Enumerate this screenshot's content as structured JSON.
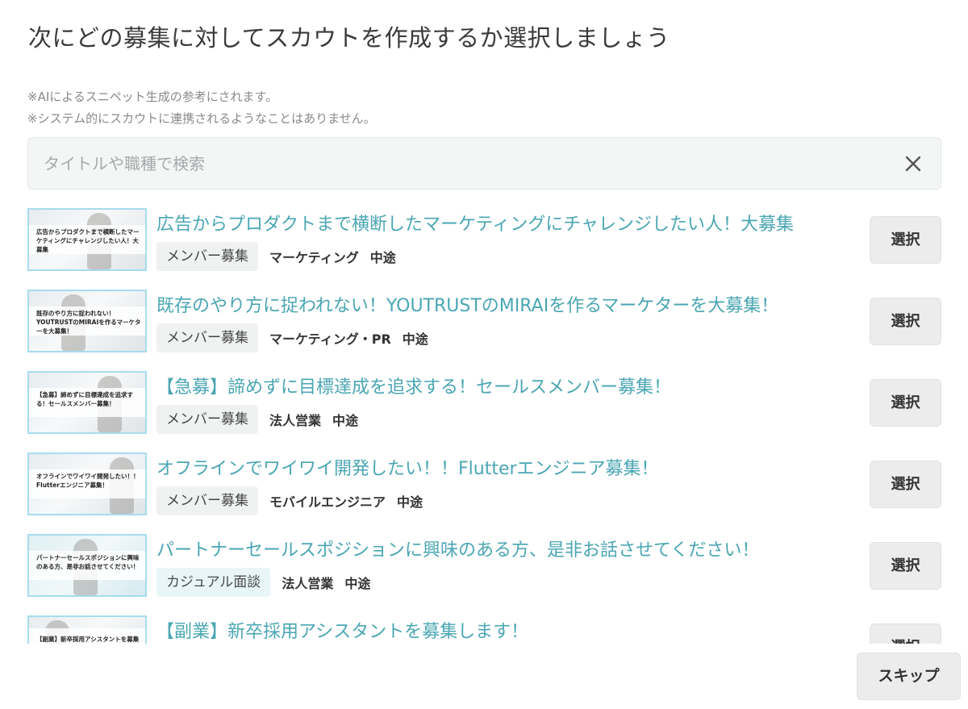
{
  "dialog": {
    "title": "次にどの募集に対してスカウトを作成するか選択しましょう",
    "notes": [
      "※AIによるスニペット生成の参考にされます。",
      "※システム的にスカウトに連携されるようなことはありません。"
    ]
  },
  "search": {
    "placeholder": "タイトルや職種で検索",
    "value": "",
    "clear_icon": "close-icon"
  },
  "jobs": [
    {
      "thumbnail_caption": "広告からプロダクトまで横断したマーケティングにチャレンジしたい人！大募集",
      "title": "広告からプロダクトまで横断したマーケティングにチャレンジしたい人！大募集",
      "recruit_type": "メンバー募集",
      "category": "マーケティング",
      "employment": "中途",
      "select_label": "選択"
    },
    {
      "thumbnail_caption": "既存のやり方に捉われない！YOUTRUSTのMIRAIを作るマーケターを大募集！",
      "title": "既存のやり方に捉われない！YOUTRUSTのMIRAIを作るマーケターを大募集！",
      "recruit_type": "メンバー募集",
      "category": "マーケティング・PR",
      "employment": "中途",
      "select_label": "選択"
    },
    {
      "thumbnail_caption": "【急募】諦めずに目標達成を追求する！セールスメンバー募集！",
      "title": "【急募】諦めずに目標達成を追求する！セールスメンバー募集！",
      "recruit_type": "メンバー募集",
      "category": "法人営業",
      "employment": "中途",
      "select_label": "選択"
    },
    {
      "thumbnail_caption": "オフラインでワイワイ開発したい！！Flutterエンジニア募集！",
      "title": "オフラインでワイワイ開発したい！！Flutterエンジニア募集！",
      "recruit_type": "メンバー募集",
      "category": "モバイルエンジニア",
      "employment": "中途",
      "select_label": "選択"
    },
    {
      "thumbnail_caption": "パートナーセールスポジションに興味のある方、是非お話させてください！",
      "title": "パートナーセールスポジションに興味のある方、是非お話させてください！",
      "recruit_type": "カジュアル面談",
      "category": "法人営業",
      "employment": "中途",
      "select_label": "選択"
    },
    {
      "thumbnail_caption": "【副業】新卒採用アシスタントを募集",
      "title": "【副業】新卒採用アシスタントを募集します！",
      "recruit_type": "",
      "category": "",
      "employment": "",
      "select_label": "選択"
    }
  ],
  "footer": {
    "skip_label": "スキップ"
  }
}
